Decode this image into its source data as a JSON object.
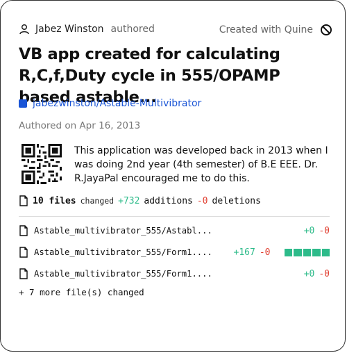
{
  "author": {
    "name": "Jabez Winston",
    "verb": "authored",
    "icon": "user-icon"
  },
  "branding": {
    "text": "Created with Quine",
    "icon": "quine-logo-icon"
  },
  "title": "VB app created for calculating R,C,f,Duty cycle in 555/OPAMP based astable...",
  "repo": {
    "name": "jabezwinston/Astable-Multivibrator",
    "icon": "repo-icon",
    "color": "#1a55d6"
  },
  "date": "Authored on Apr 16, 2013",
  "description": "This application was developed back in 2013 when I was doing 2nd year (4th semester) of B.E EEE. Dr. R.JayaPal encouraged me to do this.",
  "summary": {
    "files": "10 files",
    "changed": "changed",
    "additions": "+732",
    "additions_label": "additions",
    "deletions": "-0",
    "deletions_label": "deletions"
  },
  "files": [
    {
      "name": "Astable_multivibrator_555/Astabl...",
      "additions": "+0",
      "deletions": "-0",
      "bar_blocks": 0
    },
    {
      "name": "Astable_multivibrator_555/Form1....",
      "additions": "+167",
      "deletions": "-0",
      "bar_blocks": 5
    },
    {
      "name": "Astable_multivibrator_555/Form1....",
      "additions": "+0",
      "deletions": "-0",
      "bar_blocks": 0
    }
  ],
  "more": "+ 7 more file(s) changed",
  "colors": {
    "green": "#2dbb8a",
    "red": "#e03d2f",
    "link": "#1a55d6"
  }
}
